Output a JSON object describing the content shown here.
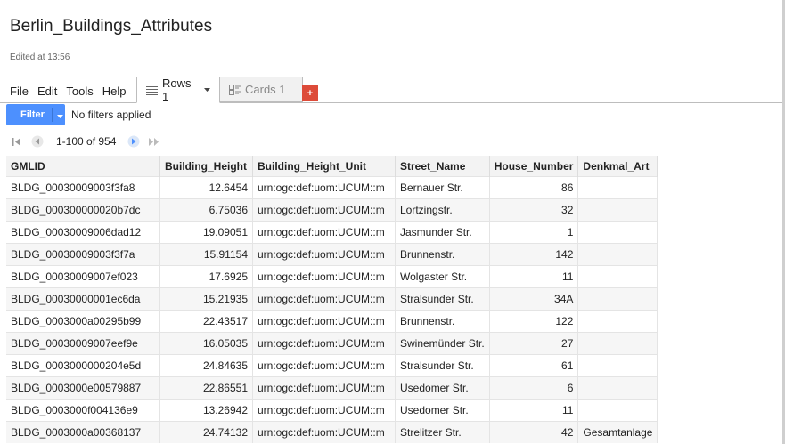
{
  "doc": {
    "title": "Berlin_Buildings_Attributes",
    "edited": "Edited at 13:56"
  },
  "menu": [
    "File",
    "Edit",
    "Tools",
    "Help"
  ],
  "tabs": {
    "rows_label": "Rows 1",
    "cards_label": "Cards 1",
    "add_label": "+"
  },
  "filter": {
    "button_label": "Filter",
    "status": "No filters applied"
  },
  "pager": {
    "range": "1-100 of 954"
  },
  "table": {
    "headers": [
      "GMLID",
      "Building_Height",
      "Building_Height_Unit",
      "Street_Name",
      "House_Number",
      "Denkmal_Art"
    ],
    "rows": [
      [
        "BLDG_00030009003f3fa8",
        "12.6454",
        "urn:ogc:def:uom:UCUM::m",
        "Bernauer Str.",
        "86",
        ""
      ],
      [
        "BLDG_000300000020b7dc",
        "6.75036",
        "urn:ogc:def:uom:UCUM::m",
        "Lortzingstr.",
        "32",
        ""
      ],
      [
        "BLDG_00030009006dad12",
        "19.09051",
        "urn:ogc:def:uom:UCUM::m",
        "Jasmunder Str.",
        "1",
        ""
      ],
      [
        "BLDG_00030009003f3f7a",
        "15.91154",
        "urn:ogc:def:uom:UCUM::m",
        "Brunnenstr.",
        "142",
        ""
      ],
      [
        "BLDG_00030009007ef023",
        "17.6925",
        "urn:ogc:def:uom:UCUM::m",
        "Wolgaster Str.",
        "11",
        ""
      ],
      [
        "BLDG_00030000001ec6da",
        "15.21935",
        "urn:ogc:def:uom:UCUM::m",
        "Stralsunder Str.",
        "34A",
        ""
      ],
      [
        "BLDG_0003000a00295b99",
        "22.43517",
        "urn:ogc:def:uom:UCUM::m",
        "Brunnenstr.",
        "122",
        ""
      ],
      [
        "BLDG_00030009007eef9e",
        "16.05035",
        "urn:ogc:def:uom:UCUM::m",
        "Swinemünder Str.",
        "27",
        ""
      ],
      [
        "BLDG_0003000000204e5d",
        "24.84635",
        "urn:ogc:def:uom:UCUM::m",
        "Stralsunder Str.",
        "61",
        ""
      ],
      [
        "BLDG_0003000e00579887",
        "22.86551",
        "urn:ogc:def:uom:UCUM::m",
        "Usedomer Str.",
        "6",
        ""
      ],
      [
        "BLDG_0003000f004136e9",
        "13.26942",
        "urn:ogc:def:uom:UCUM::m",
        "Usedomer Str.",
        "11",
        ""
      ],
      [
        "BLDG_0003000a00368137",
        "24.74132",
        "urn:ogc:def:uom:UCUM::m",
        "Strelitzer Str.",
        "42",
        "Gesamtanlage"
      ]
    ]
  }
}
